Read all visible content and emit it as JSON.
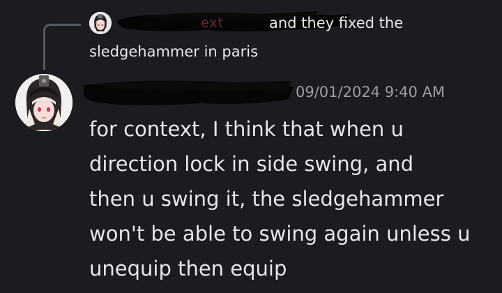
{
  "reply": {
    "author_hint": "ext",
    "text_line_1": "and they fixed the",
    "text_line_2": "sledgehammer in paris"
  },
  "message": {
    "timestamp": "09/01/2024 9:40 AM",
    "lines": [
      "for context, I think that when u",
      "direction lock in side swing, and",
      "then u swing it, the sledgehammer",
      "won't be able to swing again unless u",
      "unequip then equip"
    ]
  },
  "colors": {
    "background": "#1b1c20",
    "text": "#e6e7e9",
    "timestamp": "#9b9ea6",
    "reply_connector": "#555a61",
    "redaction": "#050505"
  }
}
